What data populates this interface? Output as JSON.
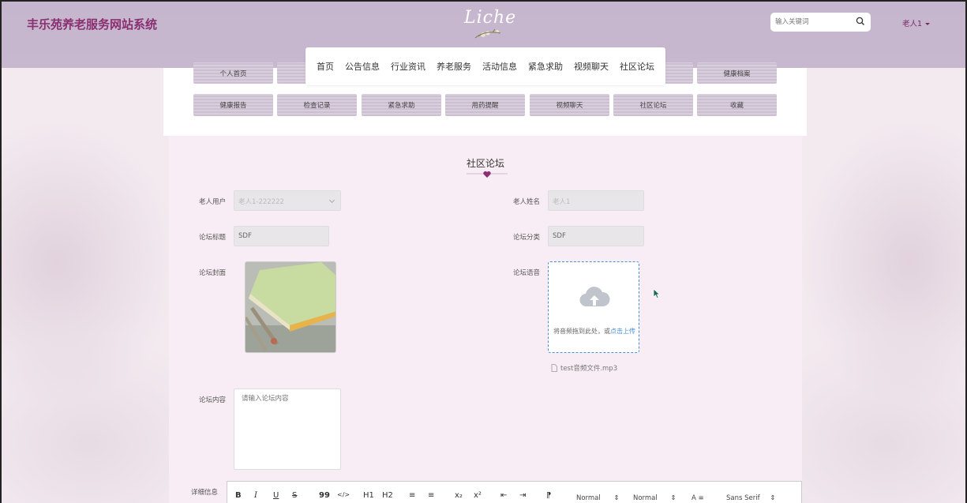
{
  "site": {
    "title": "丰乐苑养老服务网站系统",
    "logo_text": "Liche"
  },
  "search": {
    "placeholder": "输入关键词"
  },
  "user": {
    "name": "老人1"
  },
  "main_nav": [
    "首页",
    "公告信息",
    "行业资讯",
    "养老服务",
    "活动信息",
    "紧急求助",
    "视频聊天",
    "社区论坛"
  ],
  "sub_nav": {
    "row1": [
      "个人首页",
      "健康档案"
    ],
    "row2": [
      "健康报告",
      "检查记录",
      "紧急求助",
      "用药提醒",
      "视频聊天",
      "社区论坛",
      "收藏"
    ]
  },
  "page": {
    "title": "社区论坛"
  },
  "form": {
    "elder_user_label": "老人用户",
    "elder_user_value": "老人1-222222",
    "elder_name_label": "老人姓名",
    "elder_name_placeholder": "老人1",
    "forum_title_label": "论坛标题",
    "forum_title_value": "SDF",
    "forum_category_label": "论坛分类",
    "forum_category_value": "SDF",
    "forum_cover_label": "论坛封面",
    "forum_audio_label": "论坛语音",
    "upload_text": "将音频拖到此处，或",
    "upload_link": "点击上传",
    "upload_file": "test音频文件.mp3",
    "forum_content_label": "论坛内容",
    "forum_content_placeholder": "请输入论坛内容",
    "detail_label": "详细信息"
  },
  "editor": {
    "tools": [
      "B",
      "I",
      "U",
      "S",
      "99",
      "</>",
      "H1",
      "H2",
      "≡",
      "≡",
      "x₂",
      "x²",
      "⇤",
      "⇥",
      "⁋"
    ],
    "size_dropdown": "Normal",
    "header_dropdown": "Normal",
    "font_dropdown": "Sans Serif"
  },
  "colors": {
    "brand": "#8a3070",
    "header_bg": "#c5b6ce",
    "accent_link": "#4a8fd4"
  }
}
